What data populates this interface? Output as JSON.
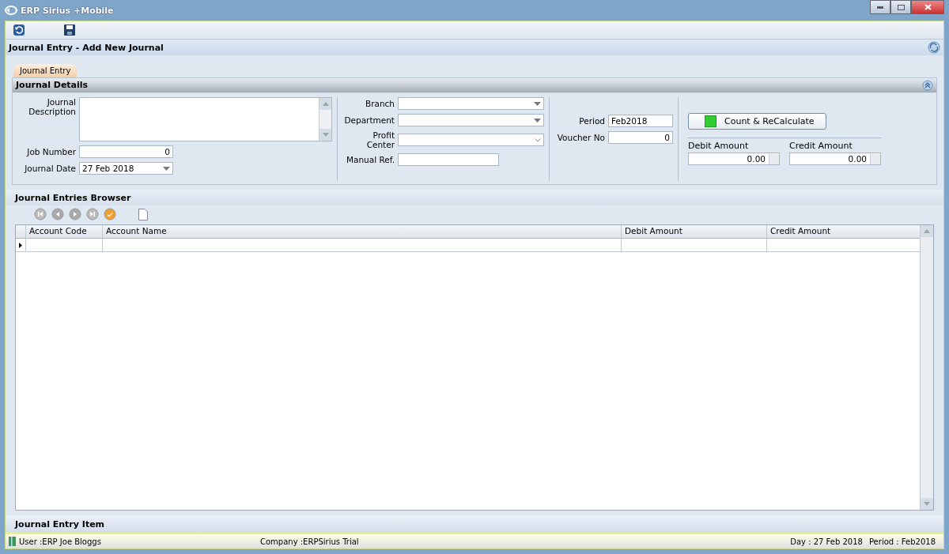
{
  "window": {
    "title": "ERP Sirius +Mobile"
  },
  "page_header": {
    "title": "Journal Entry - Add New Journal"
  },
  "tabs": [
    {
      "label": "Journal Entry",
      "selected": true
    }
  ],
  "journal_details": {
    "title": "Journal Details",
    "columns": [
      [
        {
          "label": "Journal Description",
          "kind": "textarea"
        },
        {
          "label": "Job Number",
          "kind": "number",
          "value": "0"
        },
        {
          "label": "Journal Date",
          "kind": "date",
          "value": "27 Feb 2018"
        }
      ],
      [
        {
          "label": "Branch",
          "kind": "dropdown"
        },
        {
          "label": "Department",
          "kind": "dropdown"
        },
        {
          "label": "Profit Center",
          "kind": "combo"
        },
        {
          "label": "Manual Ref.",
          "kind": "text"
        }
      ],
      [
        {
          "label": "Period",
          "kind": "text",
          "value": "Feb2018"
        },
        {
          "label": "Voucher No",
          "kind": "number",
          "value": "0"
        }
      ]
    ],
    "action_button": "Count & ReCalculate",
    "totals": [
      {
        "label": "Debit Amount",
        "value": "0.00"
      },
      {
        "label": "Credit Amount",
        "value": "0.00"
      }
    ]
  },
  "browser": {
    "title": "Journal Entries Browser",
    "columns": [
      "Account Code",
      "Account Name",
      "Debit Amount",
      "Credit Amount"
    ],
    "rows": [
      {
        "current": true
      }
    ]
  },
  "item_section": {
    "title": "Journal Entry Item"
  },
  "status_bar": {
    "user": "User :ERP Joe Bloggs",
    "company": "Company :ERPSirius Trial",
    "day": "Day : 27 Feb 2018",
    "period": "Period : Feb2018"
  }
}
